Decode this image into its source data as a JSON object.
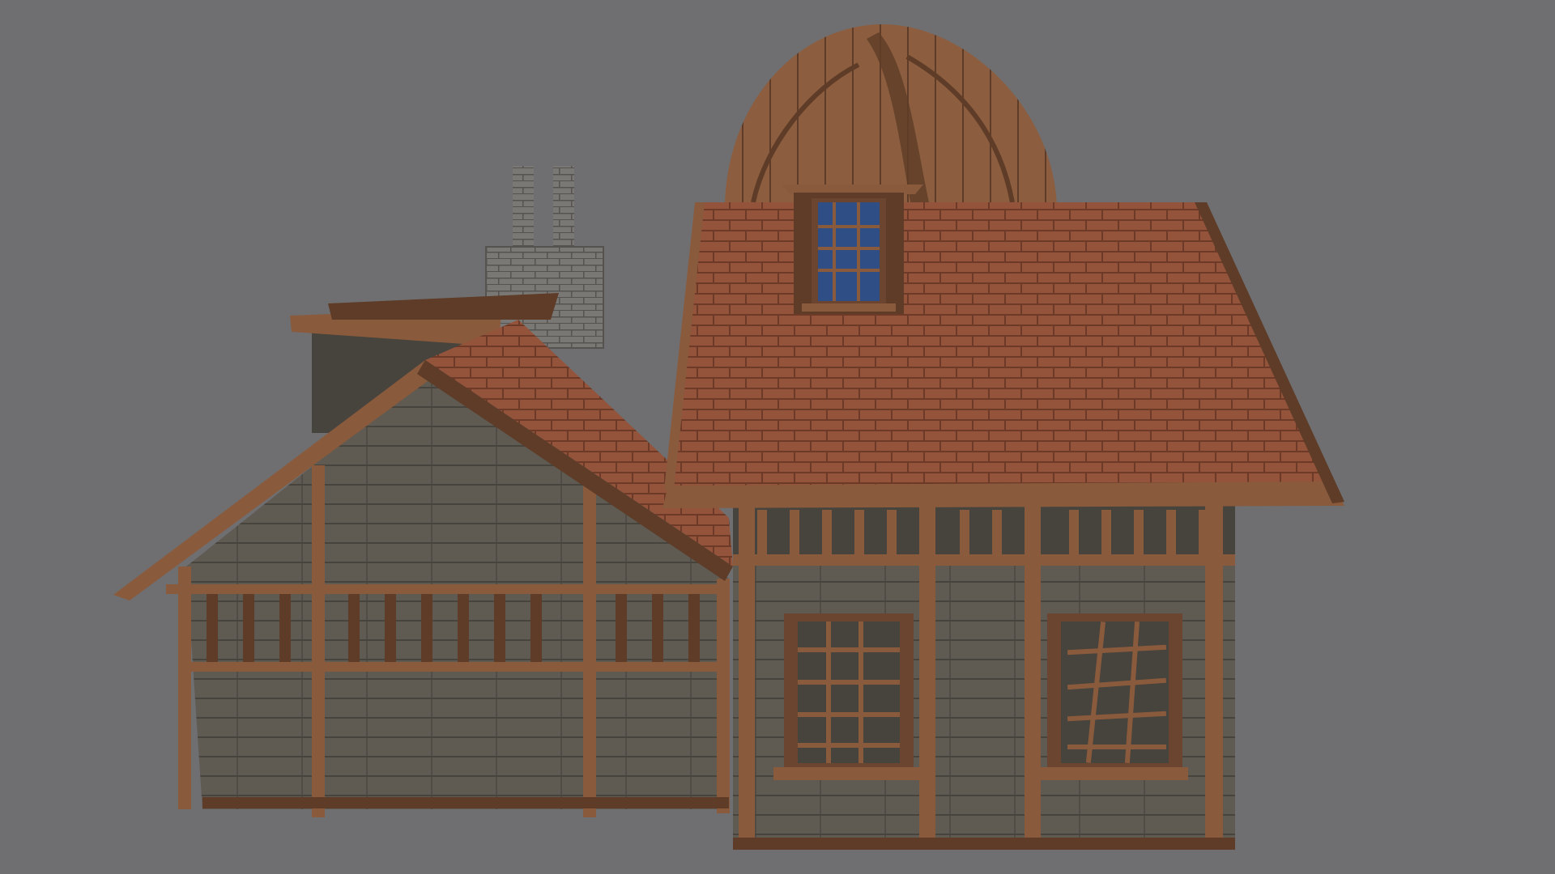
{
  "scene": {
    "subject": "wooden-house-3d-render",
    "colors": {
      "background": "#6f6f71",
      "plank": "#5f5a52",
      "plank_dark": "#47433d",
      "timber": "#8a5a3c",
      "timber_dark": "#5e3c27",
      "roof_tile": "#94533b",
      "roof_tile_dark": "#6e3a28",
      "stone": "#7a7875",
      "stone_dark": "#55524f",
      "window_glass": "#2f4e86",
      "window_frame": "#6b4530",
      "dome_wood": "#8c5e3f"
    }
  }
}
